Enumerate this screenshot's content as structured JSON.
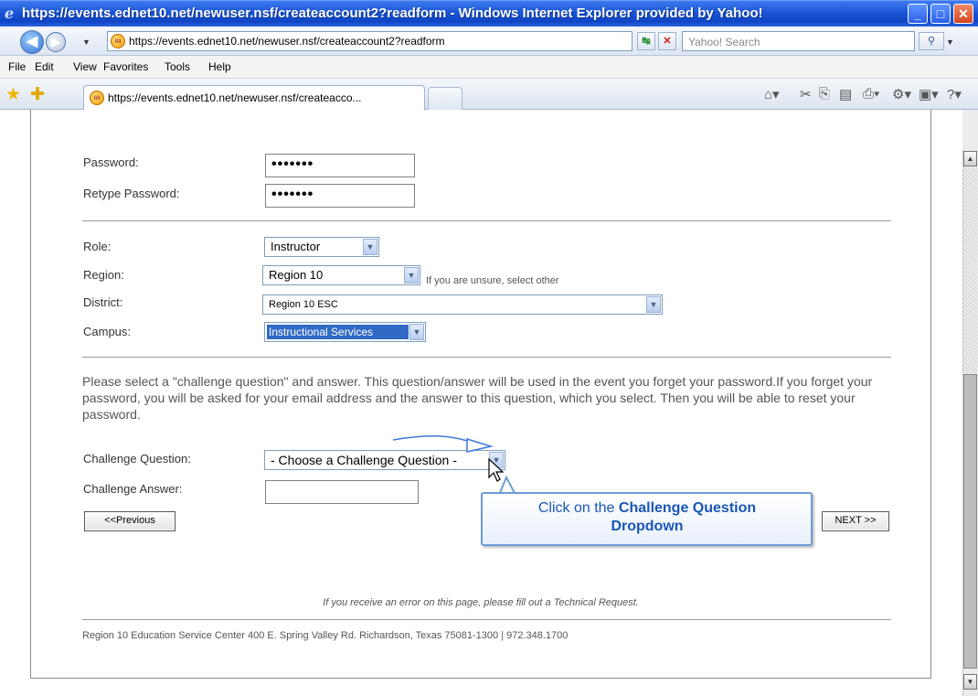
{
  "window": {
    "title": "https://events.ednet10.net/newuser.nsf/createaccount2?readform - Windows Internet Explorer provided by Yahoo!"
  },
  "address_bar": {
    "url": "https://events.ednet10.net/newuser.nsf/createaccount2?readform",
    "search_placeholder": "Yahoo! Search"
  },
  "menu": [
    "File",
    "Edit",
    "View",
    "Favorites",
    "Tools",
    "Help"
  ],
  "tab": {
    "label": "https://events.ednet10.net/newuser.nsf/createacco..."
  },
  "form": {
    "password_label": "Password:",
    "password_value": "•••••••",
    "retype_label": "Retype Password:",
    "retype_value": "•••••••",
    "role_label": "Role:",
    "role_value": "Instructor",
    "region_label": "Region:",
    "region_value": "Region 10",
    "region_hint": "If you are unsure, select other",
    "district_label": "District:",
    "district_value": "Region 10 ESC",
    "campus_label": "Campus:",
    "campus_value": "Instructional Services",
    "instructions": "Please select a \"challenge question\" and answer. This question/answer will be used in the event you forget your password.If you forget your password, you will be asked for your email address and the answer to this question, which you select. Then you will be able to reset your password.",
    "challenge_q_label": "Challenge Question:",
    "challenge_q_value": "- Choose a Challenge Question -",
    "challenge_a_label": "Challenge Answer:",
    "prev_button": "<<Previous",
    "next_button": "NEXT >>"
  },
  "callout": {
    "prefix": "Click on the ",
    "bold1": "Challenge Question",
    "bold2": "Dropdown"
  },
  "footer": {
    "note": "If you receive an error on this page, please fill out a Technical Request.",
    "address": "Region 10 Education Service Center 400 E. Spring Valley Rd. Richardson, Texas 75081-1300 | 972.348.1700"
  },
  "colors": {
    "titlebar": "#1a55d6",
    "selection": "#316ac5",
    "callout_text": "#1a56b8"
  }
}
